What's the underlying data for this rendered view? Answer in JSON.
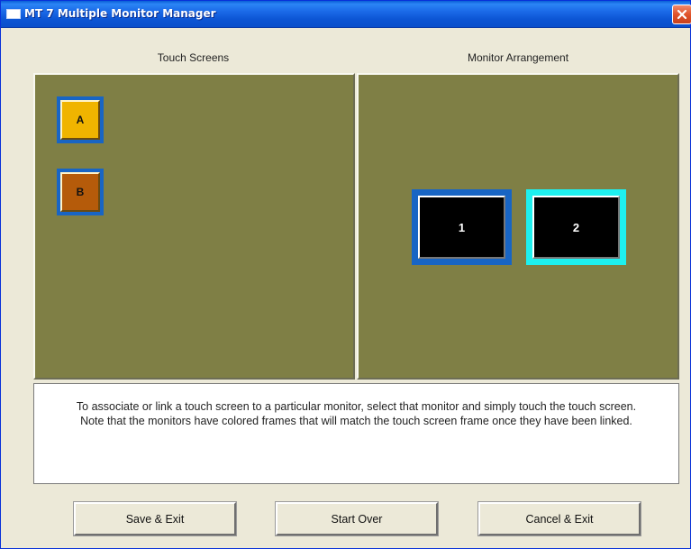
{
  "window": {
    "title": "MT 7 Multiple Monitor Manager",
    "titlebar_color": "#1b6ae8"
  },
  "touch_screens": {
    "label": "Touch Screens",
    "items": [
      {
        "label": "A",
        "color": "#f0b400",
        "frame_color": "#1865c4"
      },
      {
        "label": "B",
        "color": "#b55b0a",
        "frame_color": "#1865c4"
      }
    ]
  },
  "monitor_arrangement": {
    "label": "Monitor Arrangement",
    "monitors": [
      {
        "label": "1",
        "frame_color": "#1865c4"
      },
      {
        "label": "2",
        "frame_color": "#1ef0ef"
      }
    ]
  },
  "panel_color": "#7f7f45",
  "instructions": {
    "line1": "To associate or link a touch screen to a particular monitor, select that monitor and simply touch the touch screen.",
    "line2": "Note that the monitors have colored frames that will match the touch screen frame once they have been linked."
  },
  "buttons": {
    "save_exit": "Save & Exit",
    "start_over": "Start Over",
    "cancel_exit": "Cancel & Exit"
  }
}
